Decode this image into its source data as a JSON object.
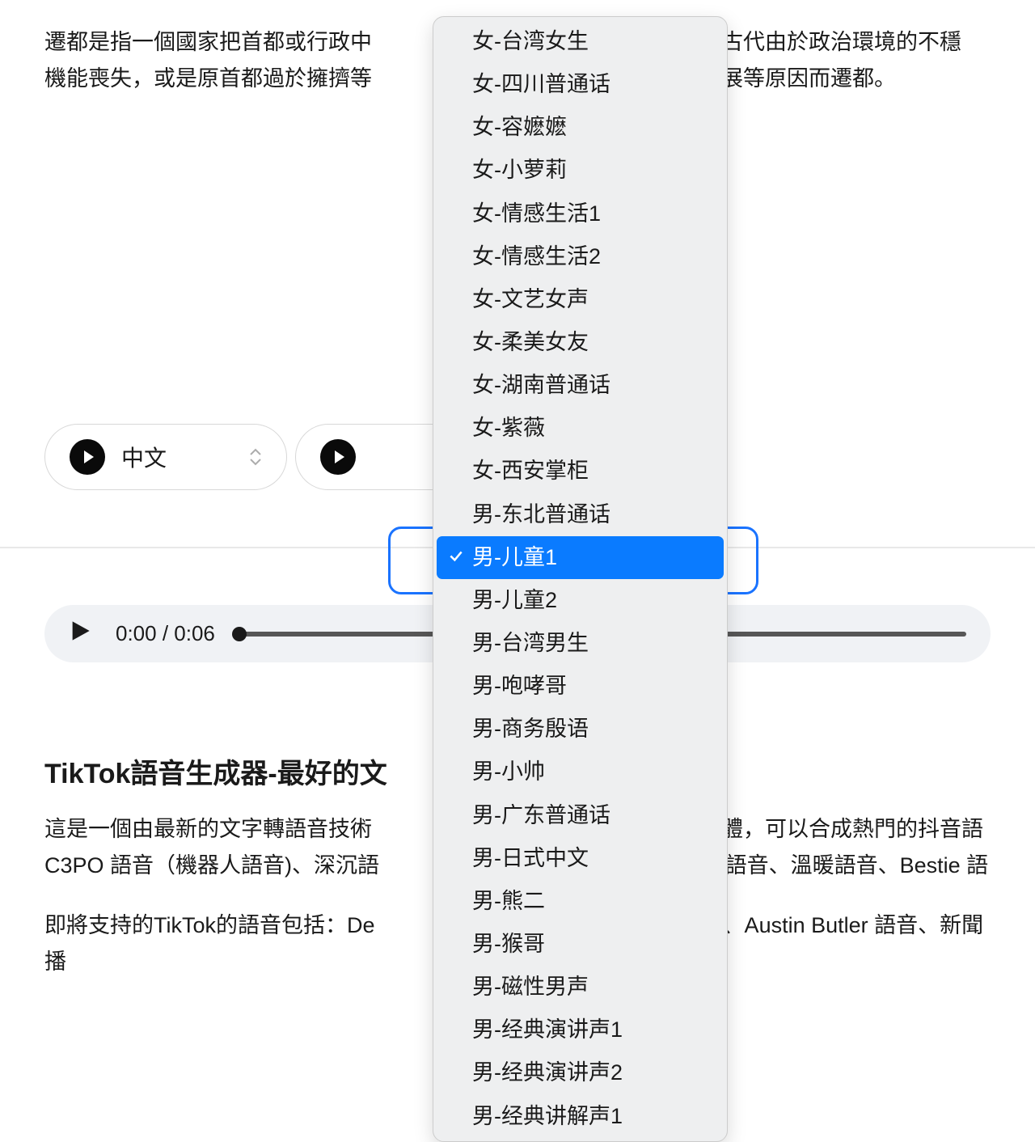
{
  "intro": {
    "line1": "遷都是指一個國家把首都或行政中",
    "line1_right": "。古代由於政治環境的不穩",
    "line2": "機能喪失，或是原首都過於擁擠等",
    "line2_right": "發展等原因而遷都。"
  },
  "selectors": {
    "language_label": "中文"
  },
  "audio": {
    "time": "0:00 / 0:06"
  },
  "article": {
    "title": "TikTok語音生成器-最好的文",
    "body_line1_left": "這是一個由最新的文字轉語音技術",
    "body_line1_right": "軟體，可以合成熱門的抖音語",
    "body_line2_left": "C3PO 語音（機器人語音)、深沉語",
    "body_line2_right": "ə 語音、溫暖語音、Bestie 語",
    "body_line3_left": "即將支持的TikTok的語音包括：De",
    "body_line3_right": "、Austin Butler 語音、新聞播"
  },
  "dropdown": {
    "selected_index": 12,
    "items": [
      "女-台湾女生",
      "女-四川普通话",
      "女-容嬷嬷",
      "女-小萝莉",
      "女-情感生活1",
      "女-情感生活2",
      "女-文艺女声",
      "女-柔美女友",
      "女-湖南普通话",
      "女-紫薇",
      "女-西安掌柜",
      "男-东北普通话",
      "男-儿童1",
      "男-儿童2",
      "男-台湾男生",
      "男-咆哮哥",
      "男-商务殷语",
      "男-小帅",
      "男-广东普通话",
      "男-日式中文",
      "男-熊二",
      "男-猴哥",
      "男-磁性男声",
      "男-经典演讲声1",
      "男-经典演讲声2",
      "男-经典讲解声1"
    ]
  }
}
